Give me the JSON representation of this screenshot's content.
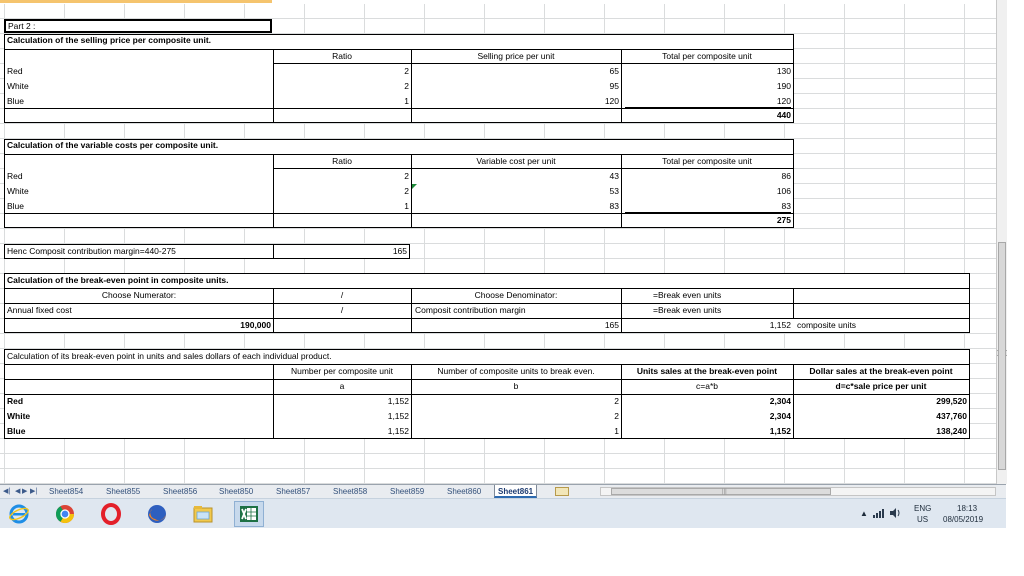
{
  "part_label": "Part 2 :",
  "s1": {
    "title": "Calculation of the selling price per composite unit.",
    "h_ratio": "Ratio",
    "h_price": "Selling price per unit",
    "h_total": "Total per composite unit",
    "rows": [
      {
        "label": "Red",
        "ratio": "2",
        "price": "65",
        "total": "130"
      },
      {
        "label": "White",
        "ratio": "2",
        "price": "95",
        "total": "190"
      },
      {
        "label": "Blue",
        "ratio": "1",
        "price": "120",
        "total": "120"
      }
    ],
    "grand_total": "440"
  },
  "s2": {
    "title": "Calculation of the variable costs per composite unit.",
    "h_ratio": "Ratio",
    "h_cost": "Variable cost per unit",
    "h_total": "Total per composite unit",
    "rows": [
      {
        "label": "Red",
        "ratio": "2",
        "cost": "43",
        "total": "86"
      },
      {
        "label": "White",
        "ratio": "2",
        "cost": "53",
        "total": "106"
      },
      {
        "label": "Blue",
        "ratio": "1",
        "cost": "83",
        "total": "83"
      }
    ],
    "grand_total": "275"
  },
  "s3": {
    "label": "Henc Composit contribution margin=440-275",
    "value": "165"
  },
  "s4": {
    "title": "Calculation of the break-even point in composite units.",
    "numerator_label": "Choose Numerator:",
    "slash": "/",
    "denominator_label": "Choose Denominator:",
    "result_label": "=Break even units",
    "fixed_cost_label": "Annual fixed cost",
    "ccm_label": "Composit contribution margin",
    "result_label2": "=Break even units",
    "fixed_cost": "190,000",
    "ccm": "165",
    "units": "1,152",
    "units_suffix": "composite units"
  },
  "s5": {
    "title": "Calculation of its break-even point in units and sales dollars of each individual product.",
    "h_a": "Number per composite unit",
    "h_b": "Number of composite units to break even.",
    "h_c": "Units sales at the break-even point",
    "h_d": "Dollar sales at the break-even point",
    "sub_a": "a",
    "sub_b": "b",
    "sub_c": "c=a*b",
    "sub_d": "d=c*sale price per unit",
    "rows": [
      {
        "label": "Red",
        "a": "1,152",
        "b": "2",
        "c": "2,304",
        "d": "299,520"
      },
      {
        "label": "White",
        "a": "1,152",
        "b": "2",
        "c": "2,304",
        "d": "437,760"
      },
      {
        "label": "Blue",
        "a": "1,152",
        "b": "1",
        "c": "1,152",
        "d": "138,240"
      }
    ]
  },
  "tabs": [
    "Sheet854",
    "Sheet855",
    "Sheet856",
    "Sheet850",
    "Sheet857",
    "Sheet858",
    "Sheet859",
    "Sheet860",
    "Sheet861"
  ],
  "active_tab": "Sheet861",
  "taskbar": {
    "icons": [
      "internet-explorer-icon",
      "chrome-icon",
      "opera-icon",
      "firefox-icon",
      "file-explorer-icon",
      "excel-icon"
    ],
    "lang": "ENG",
    "region": "US",
    "time": "18:13",
    "date": "08/05/2019"
  }
}
